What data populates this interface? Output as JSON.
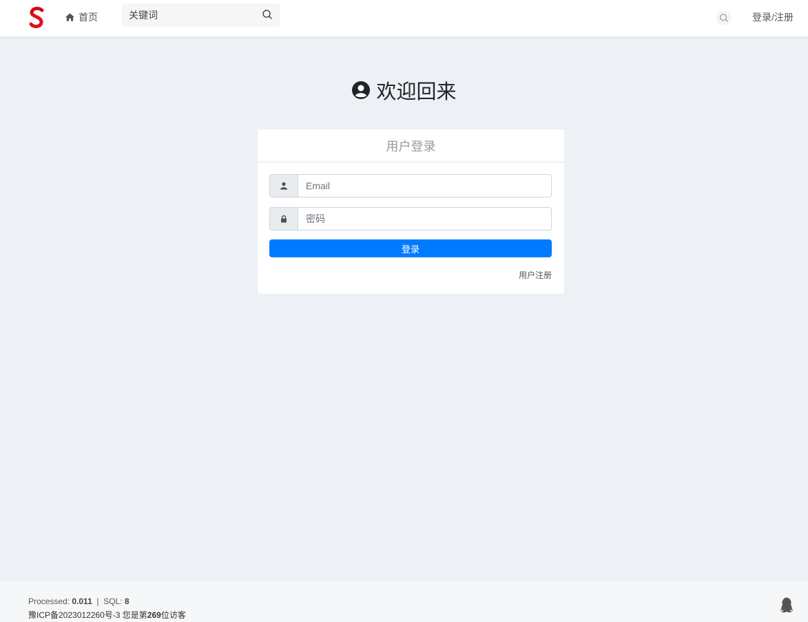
{
  "header": {
    "logo_letter": "S",
    "home_label": "首页",
    "search_placeholder": "关键词",
    "login_register": "登录/注册"
  },
  "main": {
    "welcome_title": "欢迎回来",
    "card_title": "用户登录",
    "email_placeholder": "Email",
    "password_placeholder": "密码",
    "login_button": "登录",
    "register_link": "用户注册"
  },
  "footer": {
    "processed_label": "Processed:",
    "processed_value": "0.011",
    "separator": "|",
    "sql_label": "SQL:",
    "sql_value": "8",
    "icp": "豫ICP备2023012260号-3",
    "visitor_prefix": "您是第",
    "visitor_count": "269",
    "visitor_suffix": "位访客"
  },
  "colors": {
    "accent": "#007bff",
    "logo": "#e0101b",
    "background": "#edf0f5"
  }
}
